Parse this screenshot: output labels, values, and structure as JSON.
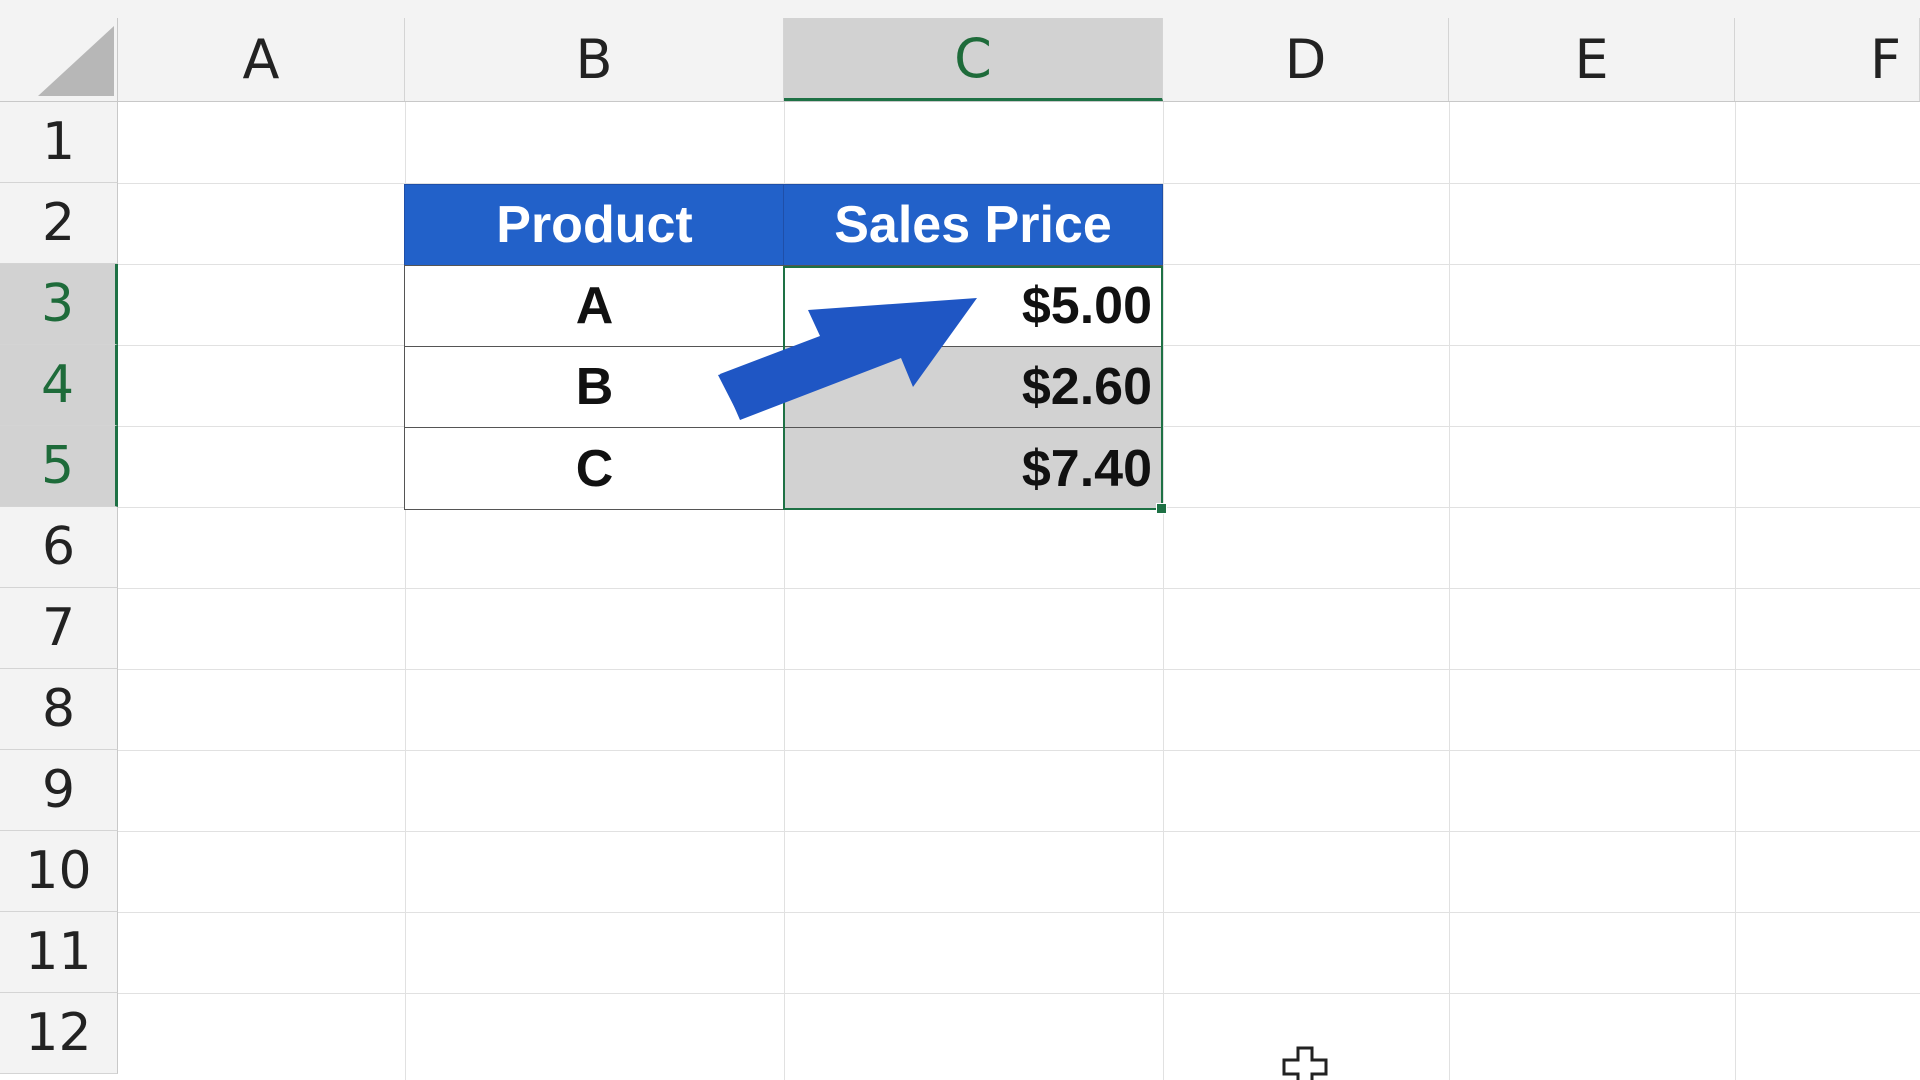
{
  "columns": [
    "A",
    "B",
    "C",
    "D",
    "E",
    "F"
  ],
  "rows": [
    "1",
    "2",
    "3",
    "4",
    "5",
    "6",
    "7",
    "8",
    "9",
    "10",
    "11",
    "12"
  ],
  "selected_column": "C",
  "selected_rows": [
    "3",
    "4",
    "5"
  ],
  "table": {
    "headers": [
      "Product",
      "Sales Price"
    ],
    "rows": [
      [
        "A",
        "$5.00"
      ],
      [
        "B",
        "$2.60"
      ],
      [
        "C",
        "$7.40"
      ]
    ]
  },
  "colors": {
    "header_fill": "#2261c9",
    "selection_green": "#1e7145",
    "selected_fill": "#d2d2d2",
    "arrow": "#1f56c4"
  },
  "icons": {
    "annotation": "arrow-icon",
    "cursor": "cell-cursor-icon"
  }
}
